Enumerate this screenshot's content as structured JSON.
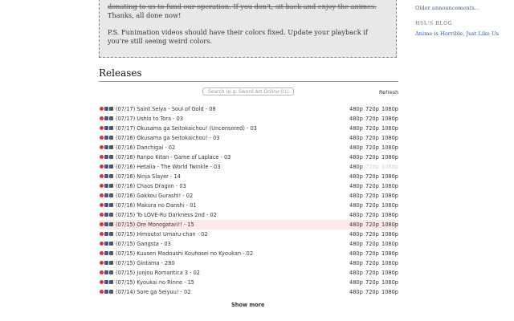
{
  "announcement": {
    "strike_line": "donating to us to fund our operation. If you don't, sit back and enjoy the animes.",
    "thanks": "Thanks, all done now!",
    "ps": "P.S. Funimation videos should have their colors fixed. Update your playback if you're still seeing weird colors."
  },
  "sidebar": {
    "older_link": "Older announcements...",
    "blog_heading": "HSL'S BLOG",
    "blog_link": "Anime is Horrible, Just Like Us"
  },
  "releases": {
    "title": "Releases",
    "search_placeholder": "Search (e.g. Sword Art Online 01)",
    "refresh_label": "Refresh",
    "show_more_label": "Show more",
    "items": [
      {
        "title": "(07/17) Saint Seiya - Soul of Gold - 08",
        "q480": "480p",
        "q720": "720p",
        "q1080": "1080p"
      },
      {
        "title": "(07/17) Ushio to Tora - 03",
        "q480": "480p",
        "q720": "720p",
        "q1080": "1080p"
      },
      {
        "title": "(07/17) Okusama ga Seitokaichou! (Uncensored) - 03",
        "q480": "480p",
        "q720": "720p",
        "q1080": "1080p"
      },
      {
        "title": "(07/16) Okusama ga Seitokaichou! - 03",
        "q480": "480p",
        "q720": "720p",
        "q1080": "1080p"
      },
      {
        "title": "(07/16) Danchigai - 02",
        "q480": "480p",
        "q720": "720p",
        "q1080": "1080p"
      },
      {
        "title": "(07/16) Ranpo Kitan - Game of Laplace - 03",
        "q480": "480p",
        "q720": "720p",
        "q1080": "1080p"
      },
      {
        "title": "(07/16) Hetalia - The World Twinkle - 03",
        "q480": "480p",
        "q720": "720p",
        "q1080": "1080p",
        "dim": true
      },
      {
        "title": "(07/16) Ninja Slayer - 14",
        "q480": "480p",
        "q720": "720p",
        "q1080": "1080p"
      },
      {
        "title": "(07/16) Chaos Dragon - 03",
        "q480": "480p",
        "q720": "720p",
        "q1080": "1080p"
      },
      {
        "title": "(07/16) Gakkou Gurashi! - 02",
        "q480": "480p",
        "q720": "720p",
        "q1080": "1080p"
      },
      {
        "title": "(07/16) Makura no Danshi - 01",
        "q480": "480p",
        "q720": "720p",
        "q1080": "1080p"
      },
      {
        "title": "(07/15) To LOVE-Ru Darkness 2nd - 02",
        "q480": "480p",
        "q720": "720p",
        "q1080": "1080p"
      },
      {
        "title": "(07/15) Ore Monogatari!! - 15",
        "q480": "480p",
        "q720": "720p",
        "q1080": "1080p",
        "highlight": true
      },
      {
        "title": "(07/15) Himouto! Umaru-chan - 02",
        "q480": "480p",
        "q720": "720p",
        "q1080": "1080p"
      },
      {
        "title": "(07/15) Gangsta - 03",
        "q480": "480p",
        "q720": "720p",
        "q1080": "1080p"
      },
      {
        "title": "(07/15) Kuusen Madoushi Kouhosei no Kyoukan - 02",
        "q480": "480p",
        "q720": "720p",
        "q1080": "1080p"
      },
      {
        "title": "(07/15) Gintama - 280",
        "q480": "480p",
        "q720": "720p",
        "q1080": "1080p"
      },
      {
        "title": "(07/15) Junjou Romantica 3 - 02",
        "q480": "480p",
        "q720": "720p",
        "q1080": "1080p"
      },
      {
        "title": "(07/15) Kyoukai no Rinne - 15",
        "q480": "480p",
        "q720": "720p",
        "q1080": "1080p"
      },
      {
        "title": "(07/14) Sore ga Seiyuu! - 02",
        "q480": "480p",
        "q720": "720p",
        "q1080": "1080p"
      }
    ]
  }
}
